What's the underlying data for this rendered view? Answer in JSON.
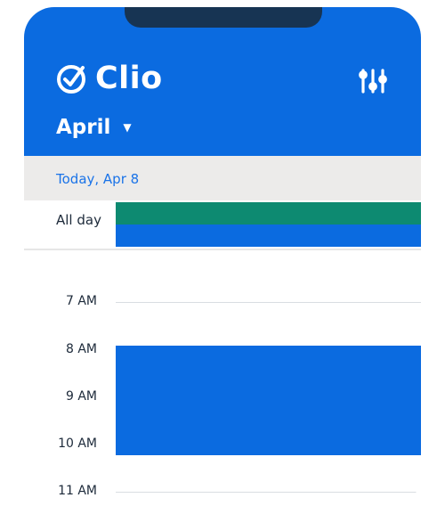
{
  "app": {
    "name": "Clio",
    "icons": {
      "logo": "check-circle-icon",
      "filter": "filter-sliders-icon",
      "caret": "caret-down-icon"
    }
  },
  "header": {
    "month": "April",
    "caret": "▼"
  },
  "day_bar": {
    "label": "Today, Apr 8"
  },
  "allday": {
    "label": "All day",
    "events": [
      {
        "color": "#0d8a71"
      },
      {
        "color": "#0b6be0"
      }
    ]
  },
  "hours": [
    "7 AM",
    "8 AM",
    "9 AM",
    "10 AM",
    "11 AM"
  ],
  "event": {
    "color": "#0b6be0"
  },
  "colors": {
    "brand_blue": "#0b6be0",
    "notch": "#173453",
    "date_bar_bg": "#ecebea",
    "date_text": "#1a73e8",
    "green_event": "#0d8a71"
  }
}
